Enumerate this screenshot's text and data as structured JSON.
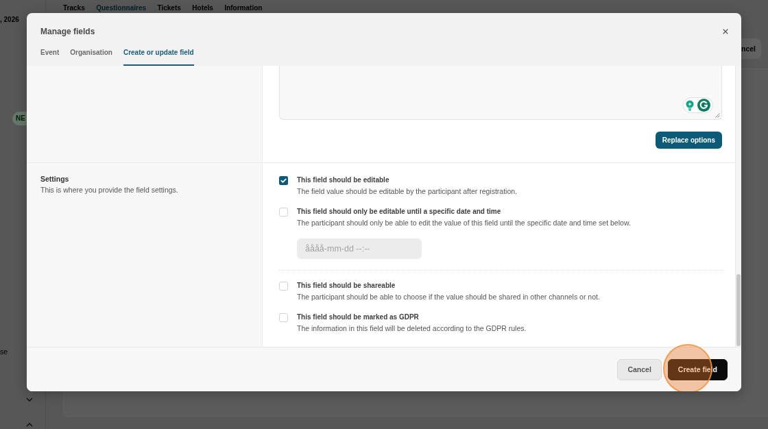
{
  "background": {
    "date_fragment": ", 2026",
    "nav_tabs": [
      {
        "label": "Tracks",
        "selected": false
      },
      {
        "label": "Questionnaires",
        "selected": true
      },
      {
        "label": "Tickets",
        "selected": false
      },
      {
        "label": "Hotels",
        "selected": false
      },
      {
        "label": "Information",
        "selected": false
      }
    ],
    "header_button": "ncel",
    "badge": "NE",
    "side_text": "se"
  },
  "dialog": {
    "title": "Manage fields",
    "tabs": [
      {
        "label": "Event",
        "selected": false
      },
      {
        "label": "Organisation",
        "selected": false
      },
      {
        "label": "Create or update field",
        "selected": true
      }
    ],
    "options_section": {
      "button": "Replace options"
    },
    "settings_section": {
      "title": "Settings",
      "description": "This is where you provide the field settings.",
      "option_groups": [
        {
          "options": [
            {
              "label": "This field should be editable",
              "description": "The field value should be editable by the participant after registration.",
              "checked": true
            },
            {
              "label": "This field should only be editable until a specific date and time",
              "description": "The participant should only be able to edit the value of this field until the specific date and time set below.",
              "checked": false,
              "date_field": {
                "placeholder": "åååå-mm-dd --:--",
                "disabled": true
              }
            }
          ]
        },
        {
          "options": [
            {
              "label": "This field should be shareable",
              "description": "The participant should be able to choose if the value should be shared in other channels or not.",
              "checked": false
            },
            {
              "label": "This field should be marked as GDPR",
              "description": "The information in this field will be deleted according to the GDPR rules.",
              "checked": false
            }
          ]
        }
      ]
    },
    "footer_buttons": [
      {
        "label": "Cancel",
        "kind": "secondary",
        "highlighted": false
      },
      {
        "label": "Create field",
        "kind": "primary",
        "highlighted": true
      }
    ]
  }
}
